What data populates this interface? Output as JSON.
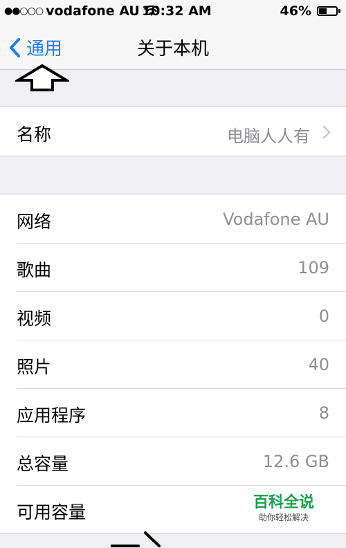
{
  "status_bar": {
    "signal": "●●○○○",
    "carrier": "vodafone AU",
    "time": "10:32 AM",
    "battery_text": "46%",
    "battery_level": 0.46
  },
  "nav": {
    "back_label": "通用",
    "title": "关于本机"
  },
  "name_row": {
    "label": "名称",
    "value": "电脑人人有"
  },
  "info_rows": [
    {
      "label": "网络",
      "value": "Vodafone AU"
    },
    {
      "label": "歌曲",
      "value": "109"
    },
    {
      "label": "视频",
      "value": "0"
    },
    {
      "label": "照片",
      "value": "40"
    },
    {
      "label": "应用程序",
      "value": "8"
    },
    {
      "label": "总容量",
      "value": "12.6 GB"
    },
    {
      "label": "可用容量",
      "value": ""
    }
  ],
  "watermark": {
    "title": "百科全说",
    "subtitle": "助你轻松解决"
  },
  "colors": {
    "accent": "#1a7ef6",
    "secondary_text": "#8e8e93",
    "background": "#efeff4"
  }
}
